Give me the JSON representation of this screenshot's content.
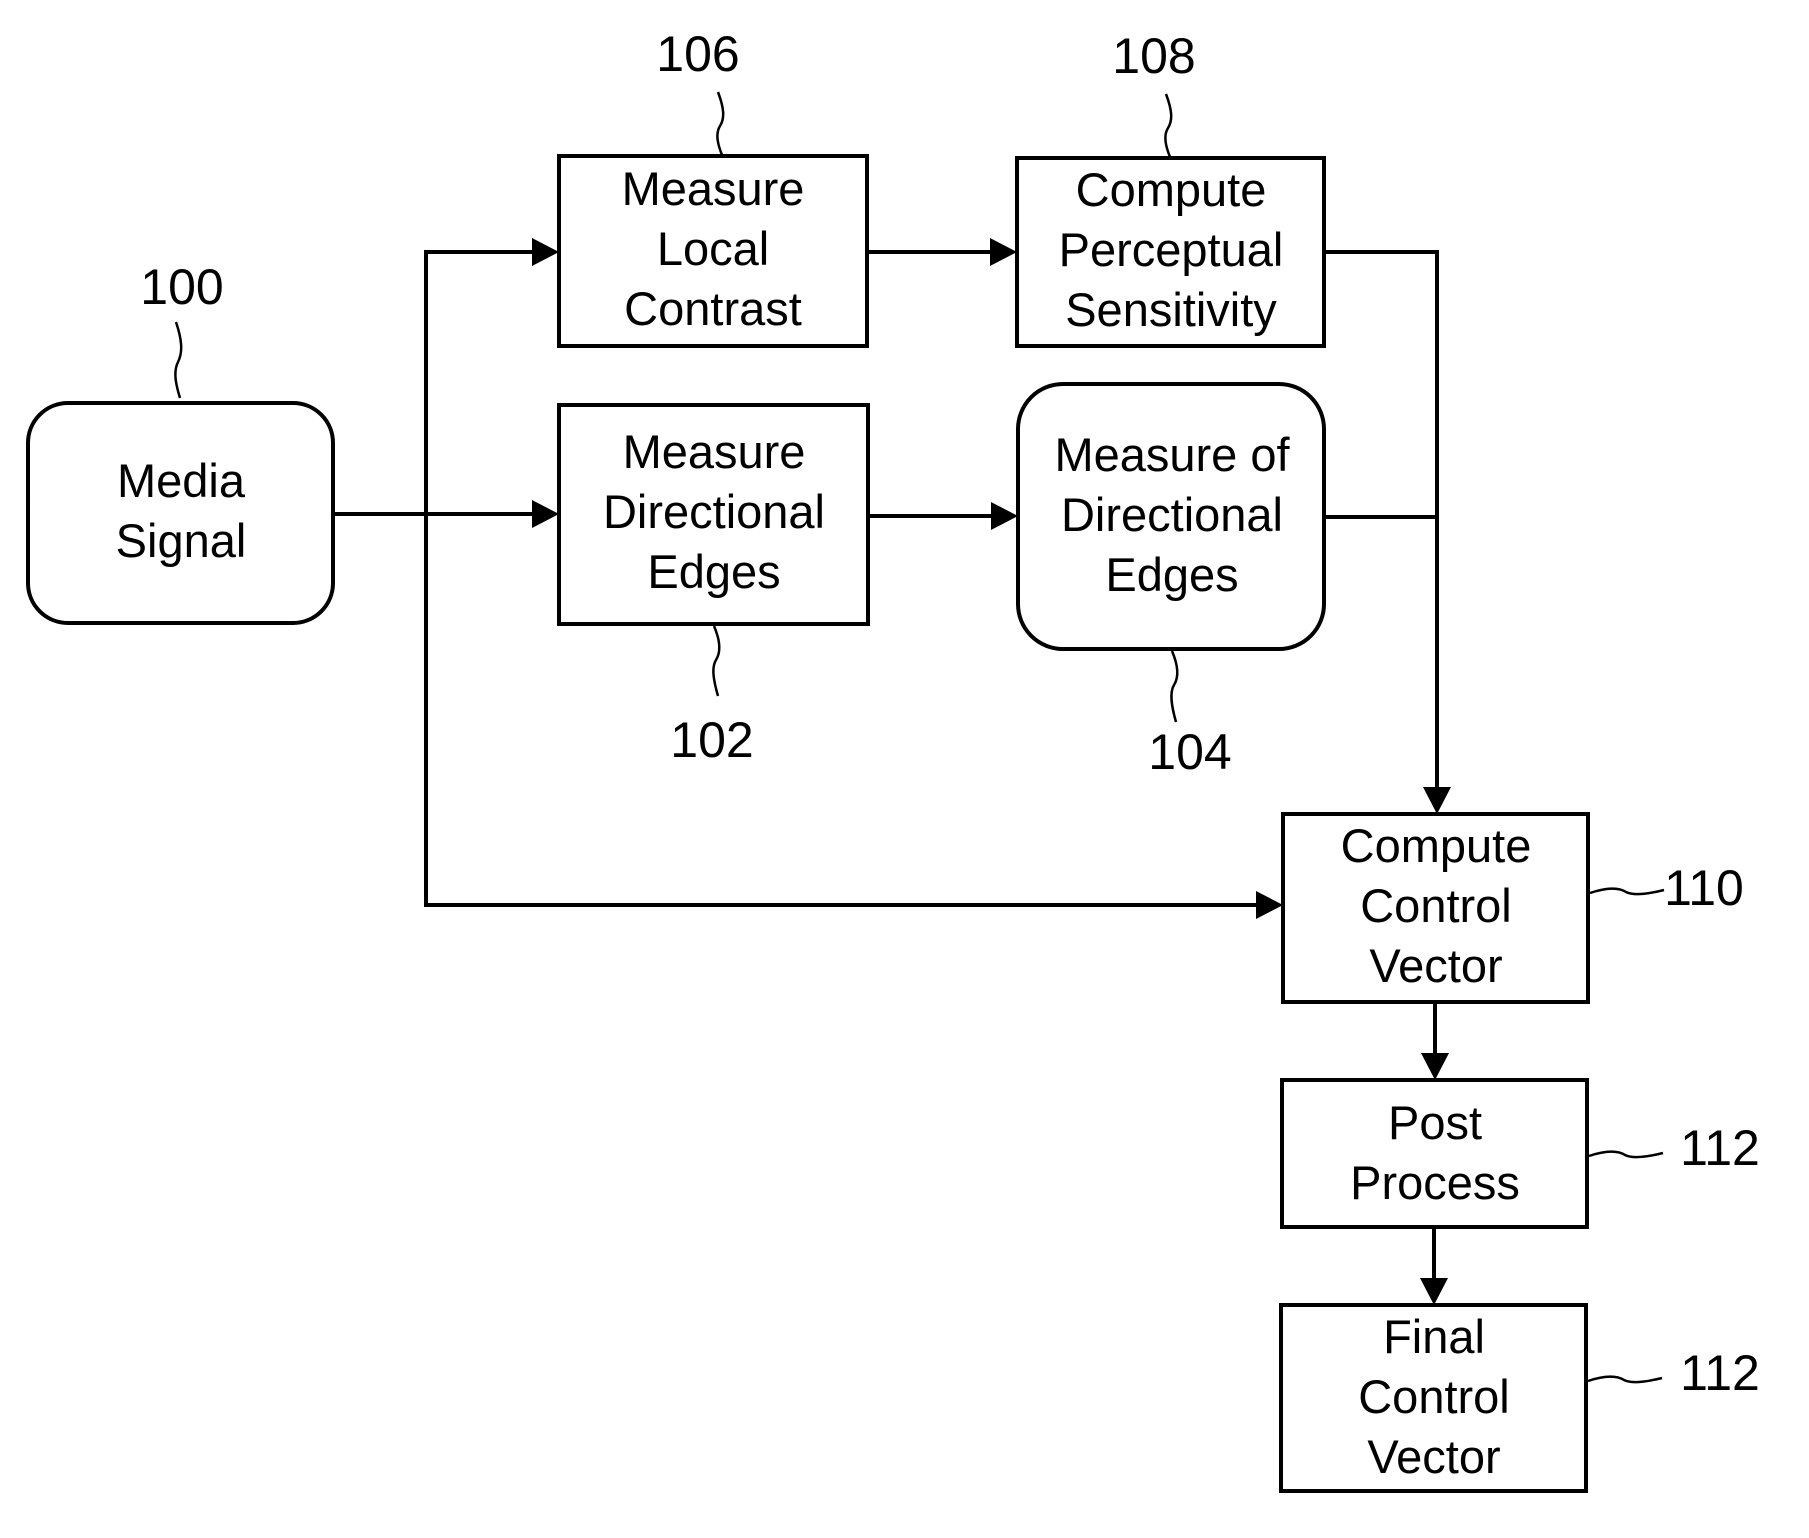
{
  "diagram": {
    "type": "flowchart",
    "nodes": [
      {
        "id": "media_signal",
        "ref": "100",
        "shape": "rounded",
        "lines": [
          "Media",
          "Signal"
        ]
      },
      {
        "id": "measure_local_contrast",
        "ref": "106",
        "shape": "rect",
        "lines": [
          "Measure",
          "Local",
          "Contrast"
        ]
      },
      {
        "id": "compute_perceptual_sensitivity",
        "ref": "108",
        "shape": "rect",
        "lines": [
          "Compute",
          "Perceptual",
          "Sensitivity"
        ]
      },
      {
        "id": "measure_directional_edges",
        "ref": "102",
        "shape": "rect",
        "lines": [
          "Measure",
          "Directional",
          "Edges"
        ]
      },
      {
        "id": "measure_of_directional_edges",
        "ref": "104",
        "shape": "rounded",
        "lines": [
          "Measure of",
          "Directional",
          "Edges"
        ]
      },
      {
        "id": "compute_control_vector",
        "ref": "110",
        "shape": "rect",
        "lines": [
          "Compute",
          "Control",
          "Vector"
        ]
      },
      {
        "id": "post_process",
        "ref": "112",
        "shape": "rect",
        "lines": [
          "Post",
          "Process"
        ]
      },
      {
        "id": "final_control_vector",
        "ref": "112",
        "shape": "rect",
        "lines": [
          "Final",
          "Control",
          "Vector"
        ]
      }
    ],
    "edges": [
      {
        "from": "media_signal",
        "to": "measure_local_contrast"
      },
      {
        "from": "media_signal",
        "to": "measure_directional_edges"
      },
      {
        "from": "media_signal",
        "to": "compute_control_vector"
      },
      {
        "from": "measure_local_contrast",
        "to": "compute_perceptual_sensitivity"
      },
      {
        "from": "measure_directional_edges",
        "to": "measure_of_directional_edges"
      },
      {
        "from": "compute_perceptual_sensitivity",
        "to": "compute_control_vector"
      },
      {
        "from": "measure_of_directional_edges",
        "to": "compute_control_vector"
      },
      {
        "from": "compute_control_vector",
        "to": "post_process"
      },
      {
        "from": "post_process",
        "to": "final_control_vector"
      }
    ]
  }
}
